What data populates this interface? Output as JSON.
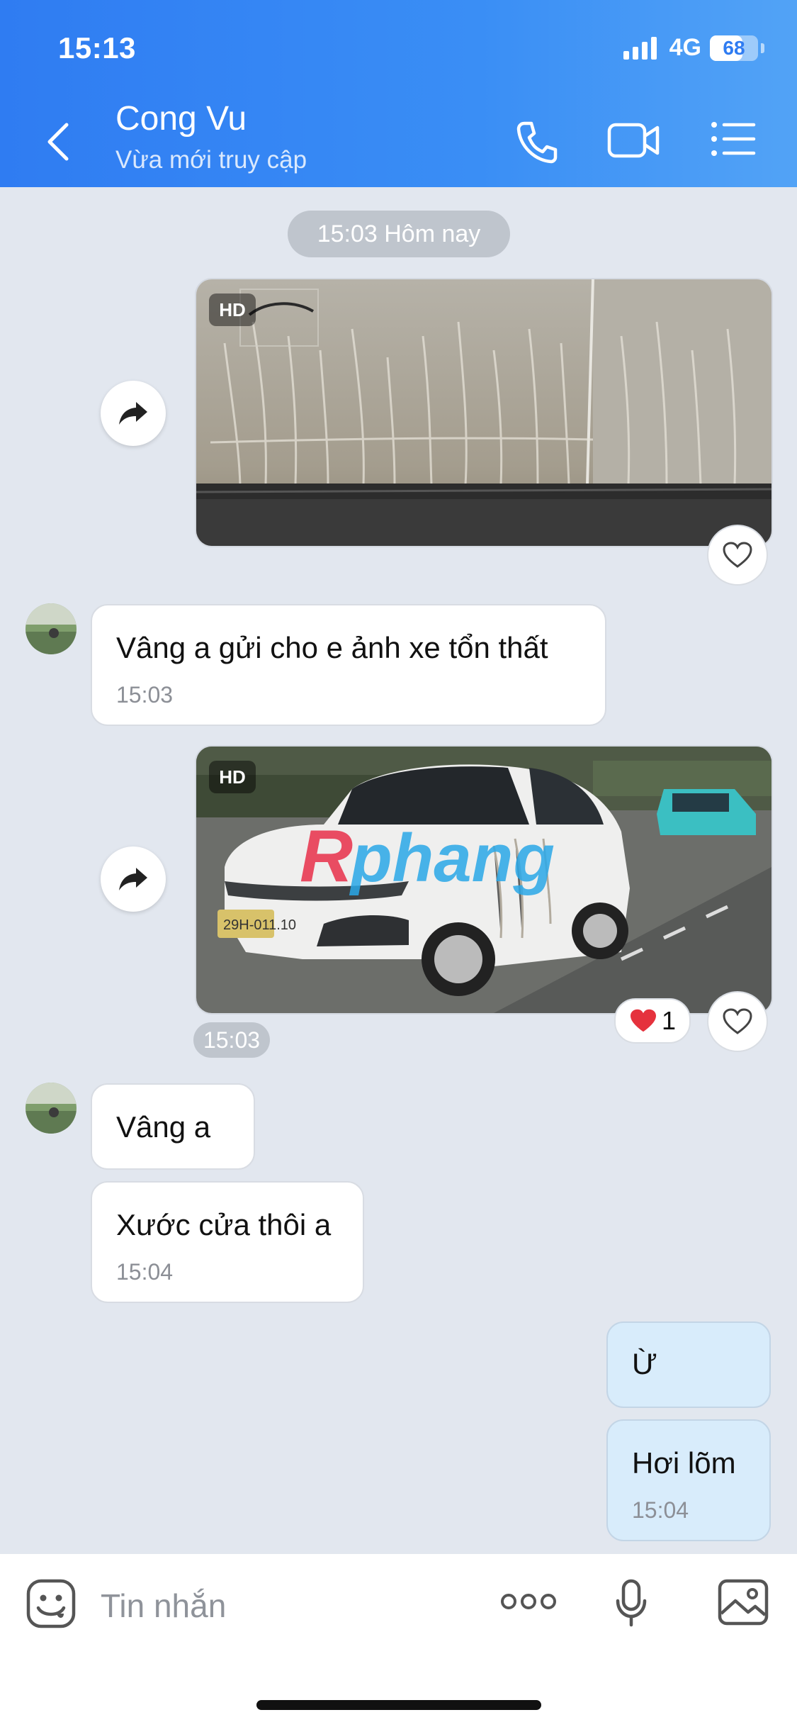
{
  "status_bar": {
    "time": "15:13",
    "network": "4G",
    "battery": "68",
    "battery_level": 0.68
  },
  "header": {
    "title": "Cong Vu",
    "subtitle": "Vừa mới truy cập"
  },
  "chat": {
    "date_separator": "15:03 Hôm nay",
    "image1": {
      "badge": "HD"
    },
    "msg1": {
      "text": "Vâng a gửi cho e ảnh xe tổn thất",
      "time": "15:03"
    },
    "image2": {
      "badge": "HD",
      "watermark": "Rphang",
      "time": "15:03",
      "reaction_count": "1",
      "plate": "29H-011.10"
    },
    "msg2": {
      "text": "Vâng a"
    },
    "msg3": {
      "text": "Xước cửa thôi a",
      "time": "15:04"
    },
    "msg4": {
      "text": "Ừ"
    },
    "msg5": {
      "text": "Hơi lõm",
      "time": "15:04"
    }
  },
  "input": {
    "placeholder": "Tin nhắn"
  },
  "colors": {
    "header_start": "#2f7cf2",
    "header_end": "#52a3f6",
    "chat_bg": "#e2e7ef",
    "outgoing_bubble": "#d8ecfb",
    "incoming_bubble": "#ffffff",
    "watermark_red": "#e8304a",
    "watermark_blue": "#2aa8e8"
  },
  "icons": [
    "back-icon",
    "phone-icon",
    "video-call-icon",
    "menu-list-icon",
    "forward-icon",
    "heart-icon",
    "sticker-icon",
    "more-icon",
    "microphone-icon",
    "image-icon"
  ]
}
